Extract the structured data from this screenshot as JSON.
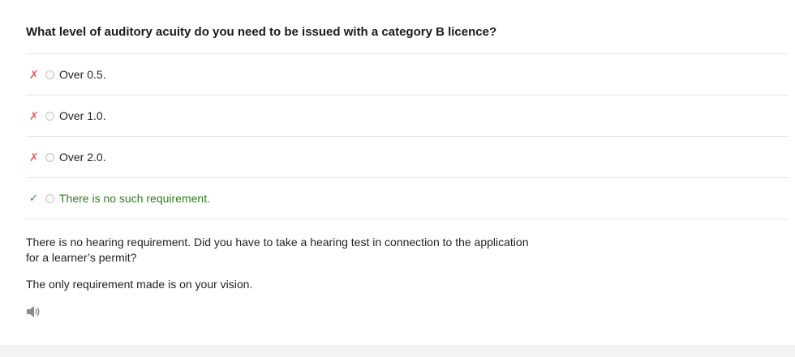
{
  "question": {
    "title": "What level of auditory acuity do you need to be issued with a category B licence?"
  },
  "options": [
    {
      "label": "Over 0.5.",
      "mark": "✗",
      "status": "wrong"
    },
    {
      "label": "Over 1.0.",
      "mark": "✗",
      "status": "wrong"
    },
    {
      "label": "Over 2.0.",
      "mark": "✗",
      "status": "wrong"
    },
    {
      "label": "There is no such requirement.",
      "mark": "✓",
      "status": "correct"
    }
  ],
  "explanation": {
    "paragraph_1": "There is no hearing requirement. Did you have to take a hearing test in connection to the application for a learner’s permit?",
    "paragraph_2": "The only requirement made is on your vision."
  },
  "audio": {
    "icon": "speaker-icon"
  },
  "colors": {
    "wrong_mark": "#e06060",
    "correct_mark": "#2e8b2e",
    "correct_text": "#2e7d1e",
    "divider": "#e6e6e6"
  }
}
